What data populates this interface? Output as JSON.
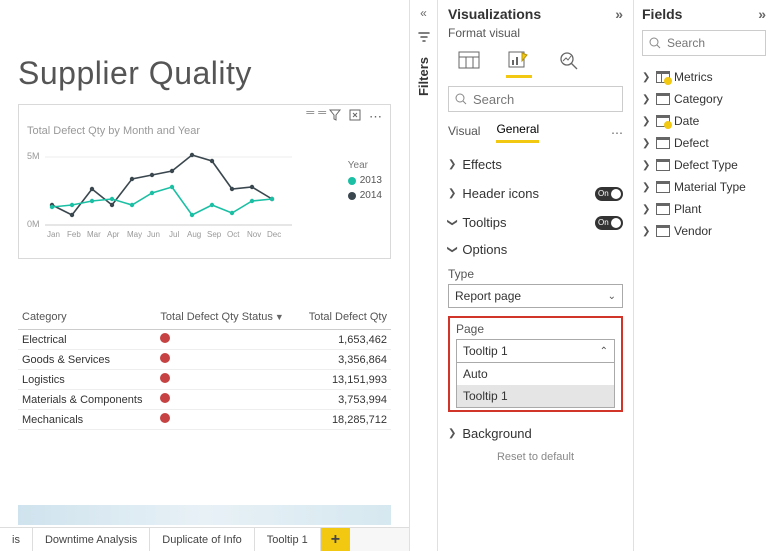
{
  "report": {
    "title": "Supplier Quality"
  },
  "chart": {
    "title": "Total Defect Qty by Month and Year",
    "legend_title": "Year",
    "series": [
      {
        "name": "2013",
        "color": "#1bbfa4"
      },
      {
        "name": "2014",
        "color": "#3a474e"
      }
    ],
    "y_ticks": [
      "5M",
      "0M"
    ],
    "x_ticks": [
      "Jan",
      "Feb",
      "Mar",
      "Apr",
      "May",
      "Jun",
      "Jul",
      "Aug",
      "Sep",
      "Oct",
      "Nov",
      "Dec"
    ]
  },
  "chart_data": {
    "type": "line",
    "title": "Total Defect Qty by Month and Year",
    "xlabel": "",
    "ylabel": "",
    "ylim": [
      0,
      6000000
    ],
    "categories": [
      "Jan",
      "Feb",
      "Mar",
      "Apr",
      "May",
      "Jun",
      "Jul",
      "Aug",
      "Sep",
      "Oct",
      "Nov",
      "Dec"
    ],
    "series": [
      {
        "name": "2013",
        "color": "#1bbfa4",
        "values": [
          1500000,
          1600000,
          1900000,
          2000000,
          1600000,
          2400000,
          2800000,
          800000,
          1600000,
          1000000,
          1900000,
          2000000
        ]
      },
      {
        "name": "2014",
        "color": "#3a474e",
        "values": [
          1700000,
          900000,
          2800000,
          1600000,
          3600000,
          3900000,
          4200000,
          5400000,
          4900000,
          2800000,
          3000000,
          2100000
        ]
      }
    ]
  },
  "table": {
    "cols": [
      "Category",
      "Total Defect Qty Status",
      "Total Defect Qty"
    ],
    "rows": [
      {
        "cat": "Electrical",
        "qty": "1,653,462"
      },
      {
        "cat": "Goods & Services",
        "qty": "3,356,864"
      },
      {
        "cat": "Logistics",
        "qty": "13,151,993"
      },
      {
        "cat": "Materials & Components",
        "qty": "3,753,994"
      },
      {
        "cat": "Mechanicals",
        "qty": "18,285,712"
      }
    ]
  },
  "tabs": {
    "items": [
      "is",
      "Downtime Analysis",
      "Duplicate of Info",
      "Tooltip 1"
    ],
    "add": "+"
  },
  "filters": {
    "label": "Filters"
  },
  "viz": {
    "title": "Visualizations",
    "subtitle": "Format visual",
    "search_placeholder": "Search",
    "subtabs": {
      "visual": "Visual",
      "general": "General"
    },
    "sections": {
      "effects": "Effects",
      "header_icons": "Header icons",
      "tooltips": "Tooltips",
      "options": "Options",
      "background": "Background",
      "reset": "Reset to default"
    },
    "toggle_on": "On",
    "type_label": "Type",
    "type_value": "Report page",
    "page_label": "Page",
    "page_value": "Tooltip 1",
    "page_options": [
      "Auto",
      "Tooltip 1"
    ]
  },
  "fields": {
    "title": "Fields",
    "search_placeholder": "Search",
    "items": [
      {
        "name": "Metrics",
        "badge": true,
        "kpi": true
      },
      {
        "name": "Category",
        "badge": false
      },
      {
        "name": "Date",
        "badge": true
      },
      {
        "name": "Defect",
        "badge": false
      },
      {
        "name": "Defect Type",
        "badge": false
      },
      {
        "name": "Material Type",
        "badge": false
      },
      {
        "name": "Plant",
        "badge": false
      },
      {
        "name": "Vendor",
        "badge": false
      }
    ]
  }
}
